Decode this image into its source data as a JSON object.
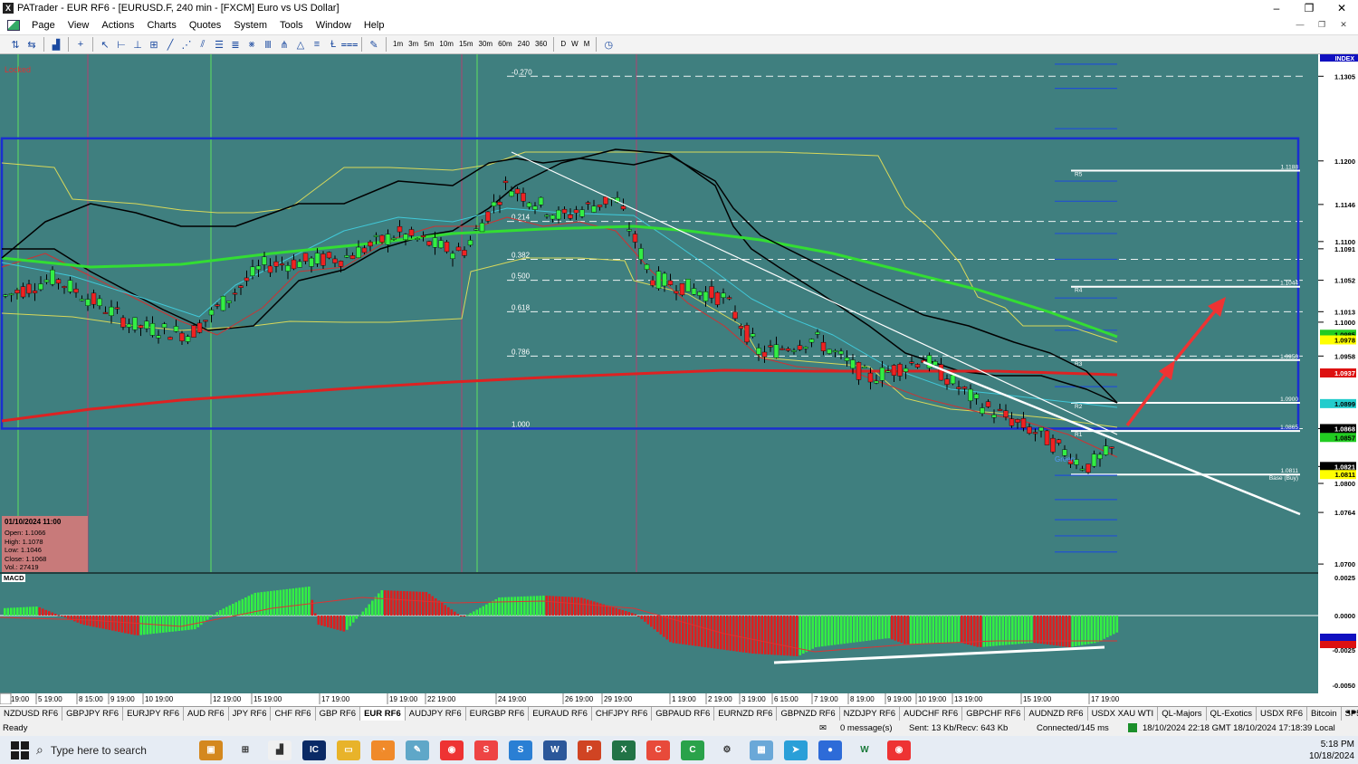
{
  "window": {
    "app_icon": "X",
    "title": "PATrader - EUR RF6 - [EURUSD.F, 240 min - [FXCM] Euro vs US Dollar]",
    "min": "–",
    "max": "❐",
    "close": "✕"
  },
  "menu": [
    "Page",
    "View",
    "Actions",
    "Charts",
    "Quotes",
    "System",
    "Tools",
    "Window",
    "Help"
  ],
  "toolbar": {
    "timeframes": [
      "1m",
      "3m",
      "5m",
      "10m",
      "15m",
      "30m",
      "60m",
      "240",
      "360"
    ],
    "periods": [
      "D",
      "W",
      "M"
    ]
  },
  "chart": {
    "locked_label": "Locked",
    "index_label": "INDEX",
    "macd_label": "MACD",
    "ohlc": {
      "date": "01/10/2024 11:00",
      "open": "Open: 1.1066",
      "high": "High: 1.1078",
      "low": "Low: 1.1046",
      "close": "Close: 1.1068",
      "vol": "Vol.: 27419"
    },
    "fib_levels": [
      {
        "label": "-0.270",
        "y": 1.1305
      },
      {
        "label": "0.214",
        "y": 1.1125
      },
      {
        "label": "0.382",
        "y": 1.1078
      },
      {
        "label": "0.500",
        "y": 1.1052
      },
      {
        "label": "0.618",
        "y": 1.1013
      },
      {
        "label": "0.786",
        "y": 1.0958
      },
      {
        "label": "1.000",
        "y": 1.0868
      }
    ],
    "pivots": [
      {
        "name": "R5",
        "value": "1.1188",
        "y": 1.1188
      },
      {
        "name": "R4",
        "value": "1.1044",
        "y": 1.1044
      },
      {
        "name": "R3",
        "value": "1.0950",
        "y": 1.0953
      },
      {
        "name": "R2",
        "value": "1.0900",
        "y": 1.09
      },
      {
        "name": "R1",
        "value": "1.0865",
        "y": 1.0865
      },
      {
        "name": "Base (Buy)",
        "value": "1.0811",
        "y": 1.0811
      }
    ],
    "green_label": "Green",
    "price_axis": [
      {
        "v": "1.1305",
        "y": 1.1305
      },
      {
        "v": "1.1200",
        "y": 1.12
      },
      {
        "v": "1.1146",
        "y": 1.1146
      },
      {
        "v": "1.1100",
        "y": 1.11
      },
      {
        "v": "1.1091",
        "y": 1.1091
      },
      {
        "v": "1.1052",
        "y": 1.1052
      },
      {
        "v": "1.1013",
        "y": 1.1013
      },
      {
        "v": "1.1000",
        "y": 1.1
      },
      {
        "v": "1.0958",
        "y": 1.0958
      },
      {
        "v": "1.0868",
        "y": 1.0868
      },
      {
        "v": "1.0821",
        "y": 1.0821
      },
      {
        "v": "1.0800",
        "y": 1.08
      },
      {
        "v": "1.0764",
        "y": 1.0764
      },
      {
        "v": "1.0700",
        "y": 1.07
      }
    ],
    "price_tags": [
      {
        "v": "1.0985",
        "y": 1.0985,
        "color": "#22cc22"
      },
      {
        "v": "1.0978",
        "y": 1.0978,
        "color": "#ffff00"
      },
      {
        "v": "1.0937",
        "y": 1.0937,
        "color": "#dd1111"
      },
      {
        "v": "1.0899",
        "y": 1.0899,
        "color": "#22cccc"
      },
      {
        "v": "1.0868",
        "y": 1.0868,
        "color": "#000000"
      },
      {
        "v": "1.0857",
        "y": 1.0857,
        "color": "#22cc22"
      },
      {
        "v": "1.0821",
        "y": 1.0821,
        "color": "#000000"
      },
      {
        "v": "1.0811",
        "y": 1.0811,
        "color": "#ffff00"
      }
    ],
    "macd_axis": [
      "0.0025",
      "0.0000",
      "-0.0025",
      "-0.0050"
    ],
    "time_axis": [
      "19:00",
      "5 19:00",
      "8 15:00",
      "9 19:00",
      "10 19:00",
      "12 19:00",
      "15 19:00",
      "17 19:00",
      "19 19:00",
      "22 19:00",
      "24 19:00",
      "26 19:00",
      "29 19:00",
      "1 19:00",
      "2 19:00",
      "3 19:00",
      "6 15:00",
      "7 19:00",
      "8 19:00",
      "9 19:00",
      "10 19:00",
      "13 19:00",
      "15 19:00",
      "17 19:00"
    ]
  },
  "tabs": [
    "NZDUSD RF6",
    "GBPJPY RF6",
    "EURJPY RF6",
    "AUD RF6",
    "JPY RF6",
    "CHF RF6",
    "GBP RF6",
    "EUR RF6",
    "AUDJPY RF6",
    "EURGBP RF6",
    "EURAUD RF6",
    "CHFJPY RF6",
    "GBPAUD RF6",
    "EURNZD RF6",
    "GBPNZD RF6",
    "NZDJPY RF6",
    "AUDCHF RF6",
    "GBPCHF RF6",
    "AUDNZD RF6",
    "USDX XAU WTI",
    "QL-Majors",
    "QL-Exotics",
    "USDX RF6",
    "Bitcoin",
    "SP500 RF6",
    "DJIA"
  ],
  "active_tab": "EUR RF6",
  "status": {
    "ready": "Ready",
    "messages": "0 message(s)",
    "traffic": "Sent: 13 Kb/Recv: 643 Kb",
    "connection": "Connected/145 ms",
    "time": "18/10/2024 22:18 GMT  18/10/2024 17:18:39 Local"
  },
  "taskbar": {
    "search": "Type here to search",
    "time": "5:18 PM",
    "date": "10/18/2024"
  }
}
